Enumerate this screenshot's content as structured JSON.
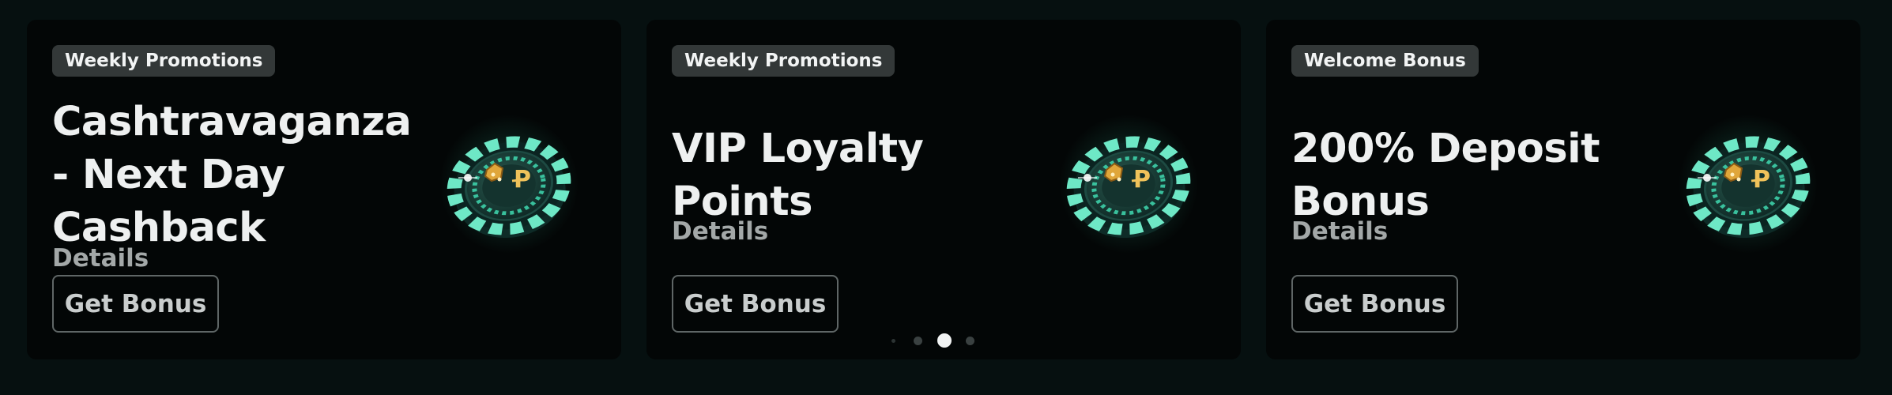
{
  "cards": [
    {
      "badge": "Weekly Promotions",
      "title": "Cashtravaganza - Next Day Cashback",
      "details": "Details",
      "button": "Get Bonus",
      "icon": "casino-chip-icon"
    },
    {
      "badge": "Weekly Promotions",
      "title": "VIP Loyalty Points",
      "details": "Details",
      "button": "Get Bonus",
      "icon": "casino-chip-icon"
    },
    {
      "badge": "Welcome Bonus",
      "title": "200% Deposit Bonus",
      "details": "Details",
      "button": "Get Bonus",
      "icon": "casino-chip-icon"
    }
  ],
  "pagination": {
    "count": 4,
    "active_index": 2
  },
  "colors": {
    "background": "#061010",
    "card": "#030606",
    "badge": "#333838",
    "accent": "#3fd9b0",
    "text": "#eef0f0",
    "muted_text": "#a3a8a8"
  }
}
